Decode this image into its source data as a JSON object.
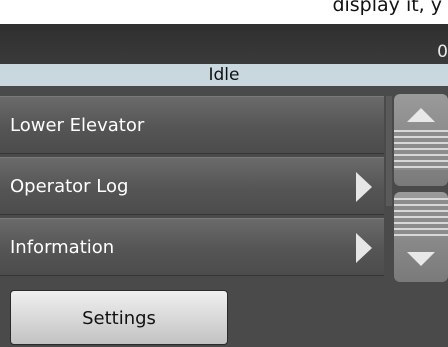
{
  "top_clip_text": "display it, y",
  "header": {
    "counter": "0"
  },
  "status": {
    "text": "Idle"
  },
  "menu": {
    "items": [
      {
        "label": "Lower Elevator",
        "has_arrow": false
      },
      {
        "label": "Operator Log",
        "has_arrow": true
      },
      {
        "label": "Information",
        "has_arrow": true
      }
    ]
  },
  "buttons": {
    "settings_label": "Settings"
  },
  "colors": {
    "background": "#4a4a4a",
    "status_bar": "#c9d7df",
    "menu_item": "#5a5a5a",
    "button": "#dcdcdc"
  }
}
